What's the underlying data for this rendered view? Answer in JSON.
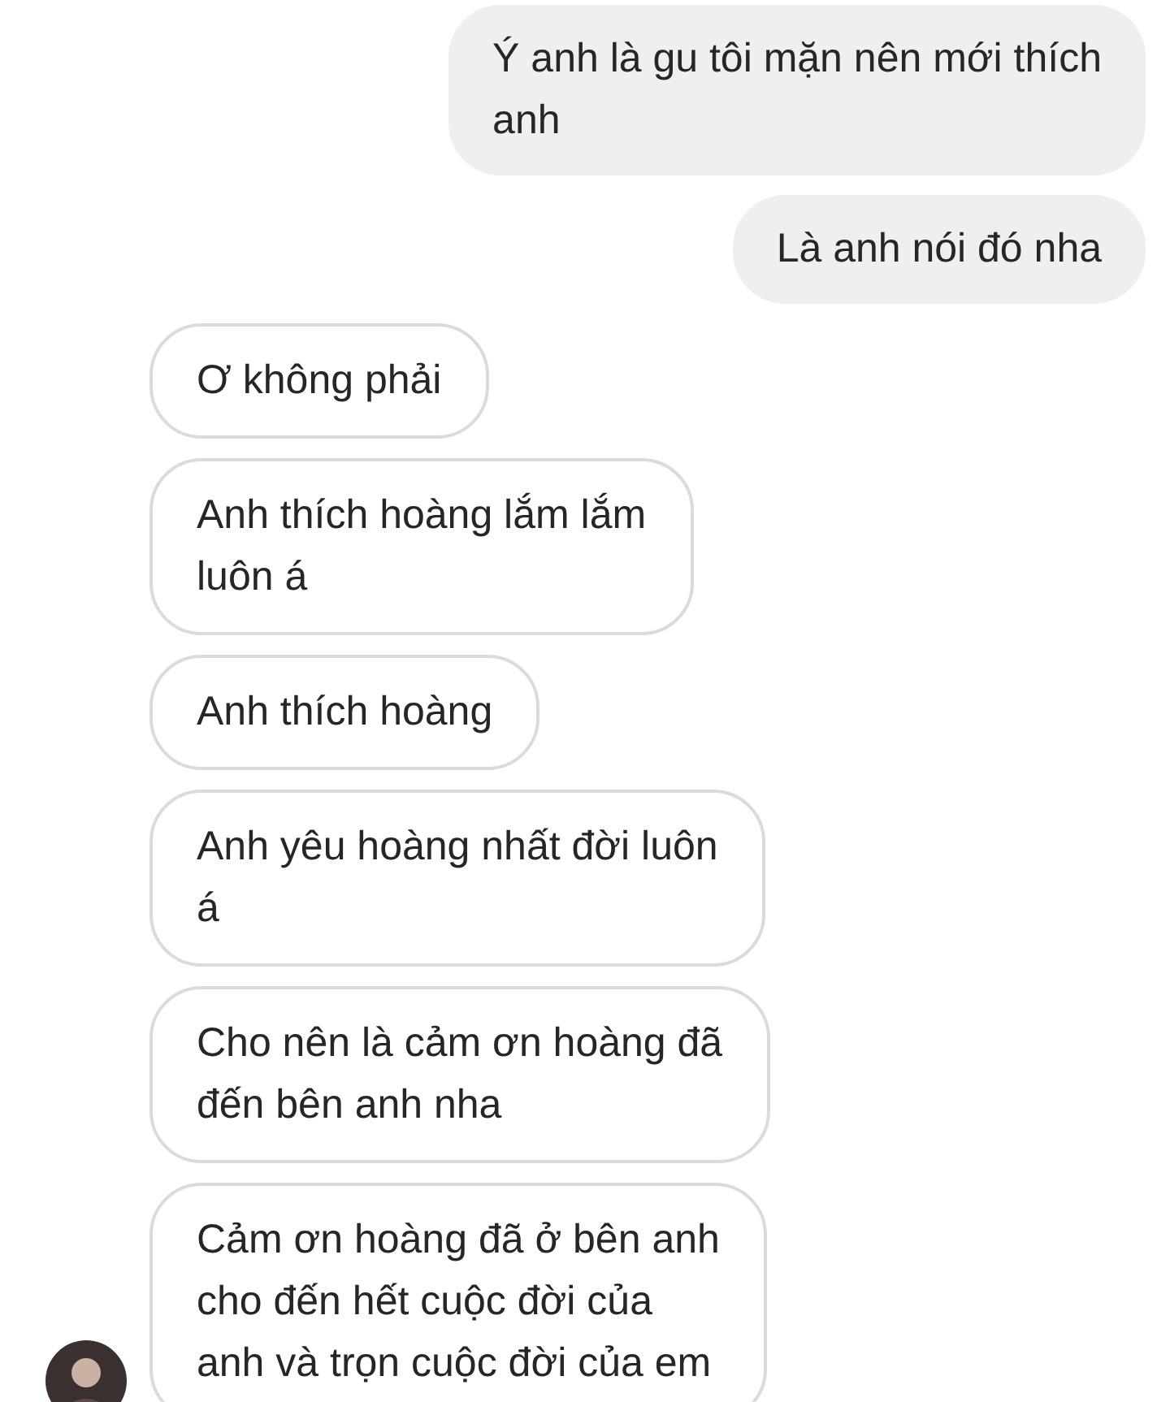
{
  "messages": [
    {
      "kind": "sent",
      "lines": [
        "Ý anh là gu tôi mặn nên mới thích",
        "anh"
      ]
    },
    {
      "kind": "sent",
      "lines": [
        "Là anh nói đó nha"
      ]
    },
    {
      "kind": "received",
      "lines": [
        "Ơ không phải"
      ]
    },
    {
      "kind": "received",
      "lines": [
        "Anh thích hoàng lắm lắm",
        "luôn á"
      ]
    },
    {
      "kind": "received",
      "lines": [
        "Anh thích hoàng"
      ]
    },
    {
      "kind": "received",
      "lines": [
        "Anh yêu hoàng nhất đời luôn",
        "á"
      ]
    },
    {
      "kind": "received",
      "lines": [
        "Cho nên là cảm ơn hoàng đã",
        "đến bên anh nha"
      ]
    },
    {
      "kind": "received",
      "lines": [
        "Cảm ơn hoàng đã ở bên anh",
        "cho đến hết cuộc đời của",
        "anh và trọn cuộc đời của em"
      ]
    }
  ]
}
